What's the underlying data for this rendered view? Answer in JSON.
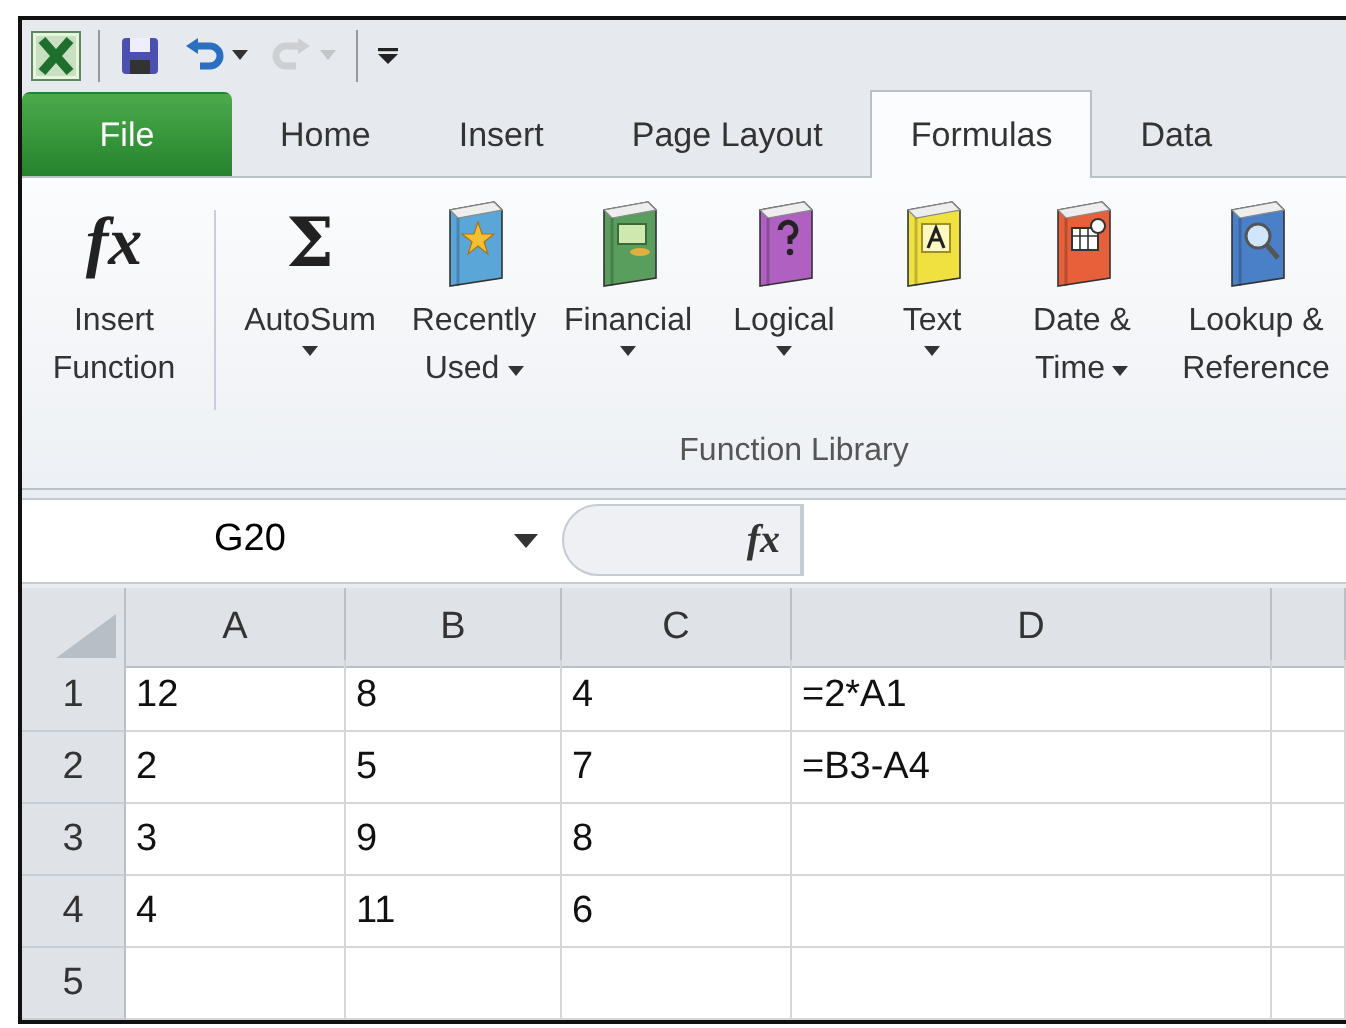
{
  "quick_access": [
    {
      "kind": "save",
      "disabled": false
    },
    {
      "kind": "undo",
      "disabled": false
    },
    {
      "kind": "redo",
      "disabled": true
    },
    {
      "kind": "customize",
      "disabled": false
    }
  ],
  "tabs": [
    {
      "label": "File",
      "kind": "file",
      "selected": false
    },
    {
      "label": "Home",
      "kind": "tab",
      "selected": false
    },
    {
      "label": "Insert",
      "kind": "tab",
      "selected": false
    },
    {
      "label": "Page Layout",
      "kind": "tab",
      "selected": false
    },
    {
      "label": "Formulas",
      "kind": "tab",
      "selected": true
    },
    {
      "label": "Data",
      "kind": "tab",
      "selected": false
    }
  ],
  "ribbon": {
    "group_label": "Function Library",
    "buttons": [
      {
        "kind": "fx",
        "symbol": "fx",
        "lines": [
          "Insert",
          "Function"
        ],
        "dropdown": false
      },
      {
        "kind": "sum",
        "symbol": "Σ",
        "lines": [
          "AutoSum"
        ],
        "dropdown": true
      },
      {
        "kind": "star",
        "color": "#5aa6d8",
        "lines": [
          "Recently",
          "Used"
        ],
        "dropdown": true
      },
      {
        "kind": "money",
        "color": "#5a9e5e",
        "lines": [
          "Financial"
        ],
        "dropdown": true
      },
      {
        "kind": "question",
        "color": "#b060c0",
        "lines": [
          "Logical"
        ],
        "dropdown": true
      },
      {
        "kind": "letter",
        "color": "#f0e040",
        "lines": [
          "Text"
        ],
        "dropdown": true
      },
      {
        "kind": "calendar",
        "color": "#e8603a",
        "lines": [
          "Date &",
          "Time"
        ],
        "dropdown": true
      },
      {
        "kind": "search",
        "color": "#4a80c8",
        "lines": [
          "Lookup &",
          "Reference"
        ],
        "dropdown": false
      }
    ]
  },
  "formula_bar": {
    "name_box": "G20",
    "fx_symbol": "fx"
  },
  "sheet": {
    "columns": [
      "A",
      "B",
      "C",
      "D"
    ],
    "rows": [
      {
        "number": "1",
        "cells": [
          "12",
          "8",
          "4",
          "=2*A1"
        ]
      },
      {
        "number": "2",
        "cells": [
          "2",
          "5",
          "7",
          "=B3-A4"
        ]
      },
      {
        "number": "3",
        "cells": [
          "3",
          "9",
          "8",
          ""
        ]
      },
      {
        "number": "4",
        "cells": [
          "4",
          "11",
          "6",
          ""
        ]
      },
      {
        "number": "5",
        "cells": [
          "",
          "",
          "",
          ""
        ]
      }
    ]
  }
}
